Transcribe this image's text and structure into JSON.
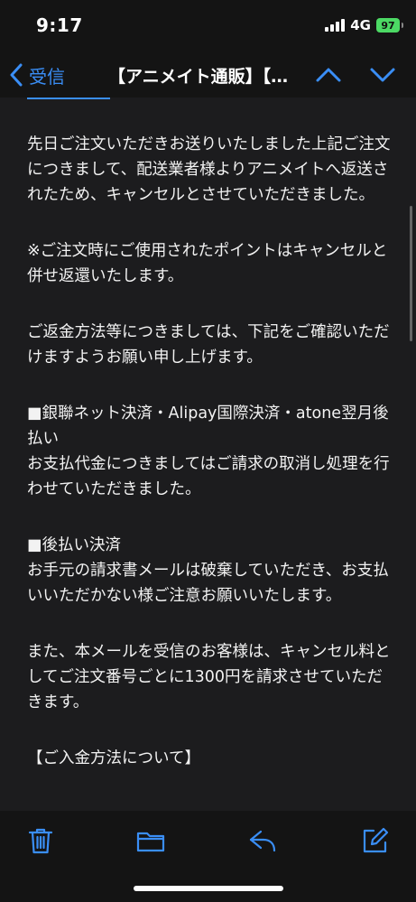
{
  "status_bar": {
    "time": "9:17",
    "network": "4G",
    "battery": "97"
  },
  "nav": {
    "back_label": "受信",
    "title": "【アニメイト通販】【重要】ご注文キャンセルのお知らせ"
  },
  "email": {
    "paragraphs": [
      "先日ご注文いただきお送りいたしました上記ご注文につきまして、配送業者様よりアニメイトへ返送されたため、キャンセルとさせていただきました。",
      "※ご注文時にご使用されたポイントはキャンセルと併せ返還いたします。",
      "ご返金方法等につきましては、下記をご確認いただけますようお願い申し上げます。",
      "■銀聯ネット決済・Alipay国際決済・atone翌月後払い\nお支払代金につきましてはご請求の取消し処理を行わせていただきました。",
      "■後払い決済\nお手元の請求書メールは破棄していただき、お支払いいただかない様ご注意お願いいたします。",
      "また、本メールを受信のお客様は、キャンセル料としてご注文番号ごとに1300円を請求させていただきます。",
      "【ご入金方法について】"
    ]
  },
  "icons": {
    "back": "chevron-left-icon",
    "up": "chevron-up-icon",
    "down": "chevron-down-icon",
    "trash": "trash-icon",
    "folder": "folder-icon",
    "reply": "reply-icon",
    "compose": "compose-icon"
  },
  "colors": {
    "accent": "#3a8ef6",
    "battery": "#4cd964",
    "background": "#1c1c1e"
  }
}
